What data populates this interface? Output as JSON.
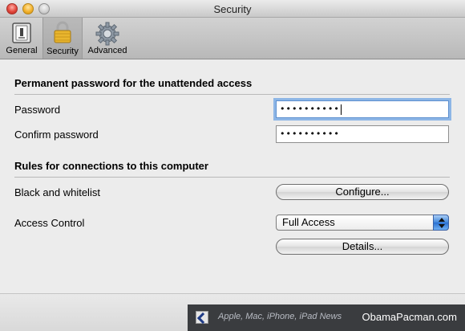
{
  "window": {
    "title": "Security"
  },
  "toolbar": {
    "tabs": [
      {
        "label": "General",
        "icon": "switch-icon"
      },
      {
        "label": "Security",
        "icon": "padlock-icon",
        "selected": true
      },
      {
        "label": "Advanced",
        "icon": "gear-icon"
      }
    ]
  },
  "password_section": {
    "title": "Permanent password for the unattended access",
    "password_label": "Password",
    "password_value": "••••••••••",
    "confirm_label": "Confirm password",
    "confirm_value": "••••••••••"
  },
  "rules_section": {
    "title": "Rules for connections to this computer",
    "blacklist_label": "Black and whitelist",
    "configure_button": "Configure...",
    "access_label": "Access Control",
    "access_value": "Full Access",
    "details_button": "Details..."
  },
  "watermark": {
    "tagline": "Apple, Mac, iPhone, iPad News",
    "site": "ObamaPacman.com"
  },
  "colors": {
    "focus_ring": "#8db6e6",
    "select_arrows": "#3f86dc",
    "watermark_bg": "#3a3c3f"
  }
}
